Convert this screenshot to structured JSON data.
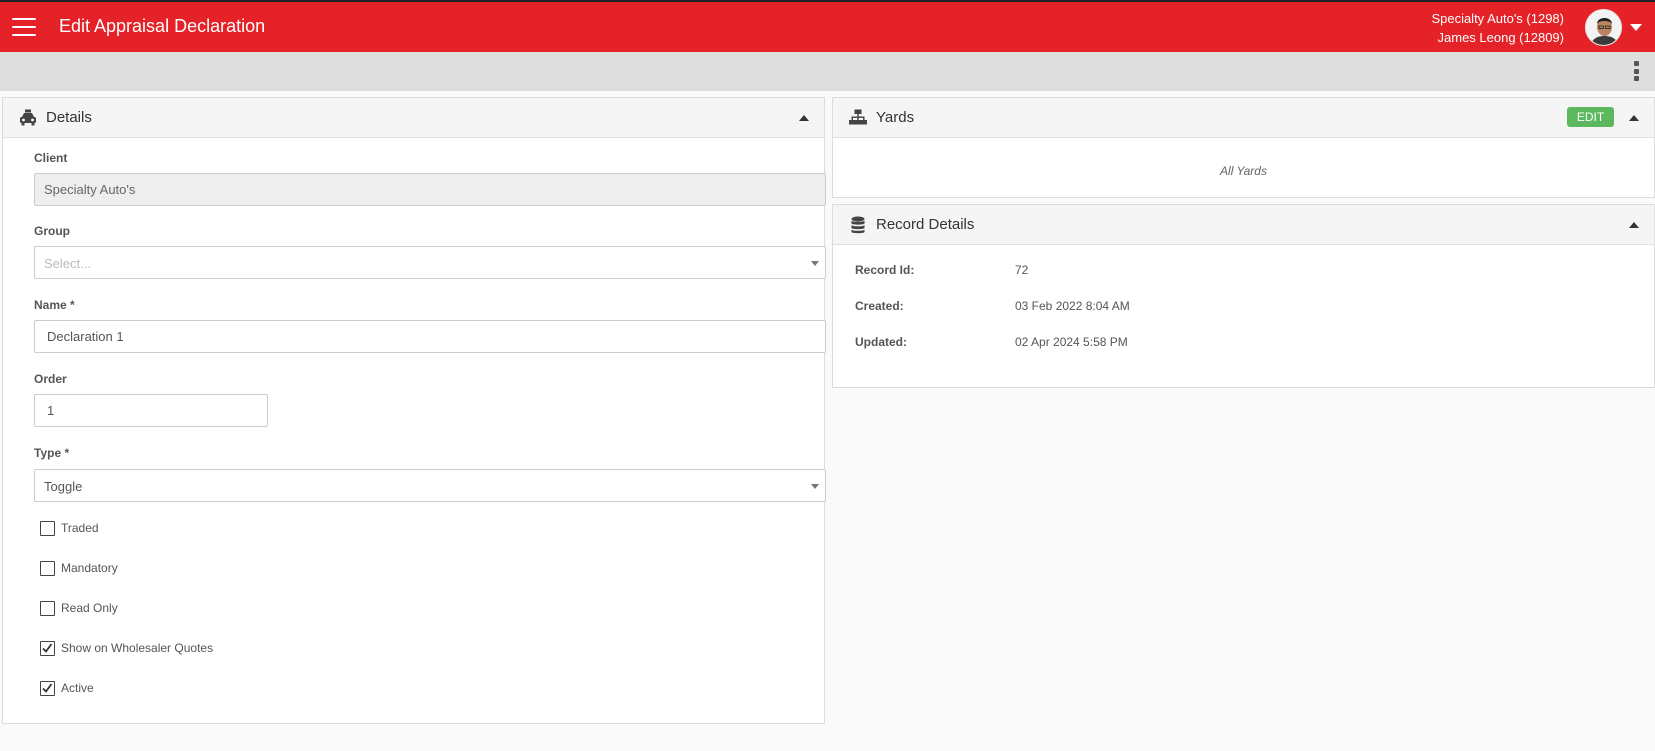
{
  "header": {
    "title": "Edit Appraisal Declaration",
    "company": "Specialty Auto's (1298)",
    "user": "James Leong (12809)"
  },
  "details": {
    "title": "Details",
    "fields": {
      "client": {
        "label": "Client",
        "value": "Specialty Auto's"
      },
      "group": {
        "label": "Group",
        "placeholder": "Select..."
      },
      "name": {
        "label": "Name *",
        "value": "Declaration 1"
      },
      "order": {
        "label": "Order",
        "value": "1"
      },
      "type": {
        "label": "Type *",
        "value": "Toggle"
      }
    },
    "checkboxes": [
      {
        "label": "Traded",
        "checked": false
      },
      {
        "label": "Mandatory",
        "checked": false
      },
      {
        "label": "Read Only",
        "checked": false
      },
      {
        "label": "Show on Wholesaler Quotes",
        "checked": true
      },
      {
        "label": "Active",
        "checked": true
      }
    ]
  },
  "yards": {
    "title": "Yards",
    "edit_label": "EDIT",
    "content": "All Yards"
  },
  "record_details": {
    "title": "Record Details",
    "rows": [
      {
        "label": "Record Id:",
        "value": "72"
      },
      {
        "label": "Created:",
        "value": "03 Feb 2022 8:04 AM"
      },
      {
        "label": "Updated:",
        "value": "02 Apr 2024 5:58 PM"
      }
    ]
  },
  "colors": {
    "brand": "#e52227",
    "edit_button": "#5cb85c"
  },
  "icons": {
    "menu": "hamburger-menu-icon",
    "details": "car-icon",
    "yards": "sitemap-icon",
    "record": "database-icon",
    "more": "more-vertical-icon"
  }
}
